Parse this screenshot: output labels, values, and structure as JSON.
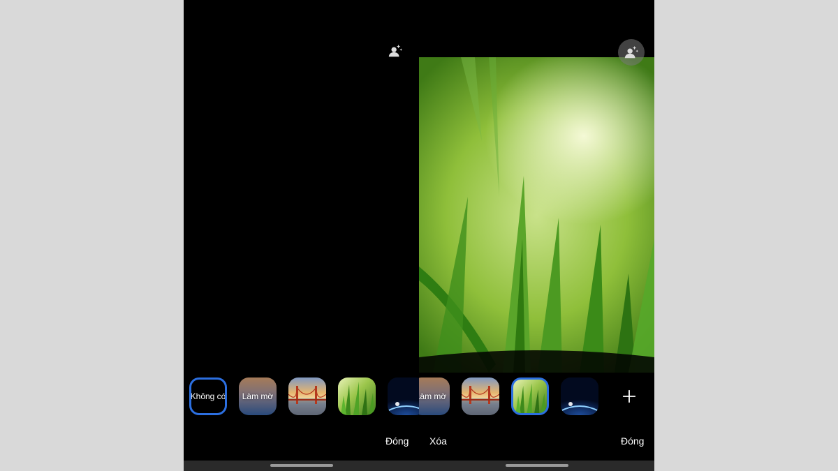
{
  "left_screen": {
    "options": [
      {
        "key": "none",
        "label": "Không có",
        "selected": true
      },
      {
        "key": "blur",
        "label": "Làm mờ",
        "selected": false
      },
      {
        "key": "bridge",
        "label": "",
        "selected": false
      },
      {
        "key": "grass",
        "label": "",
        "selected": false
      },
      {
        "key": "earth",
        "label": "",
        "selected": false
      }
    ],
    "close_label": "Đóng",
    "effect_icon": "person-sparkle-icon"
  },
  "right_screen": {
    "options": [
      {
        "key": "blur",
        "label": "Làm mờ",
        "selected": false
      },
      {
        "key": "bridge",
        "label": "",
        "selected": false
      },
      {
        "key": "grass",
        "label": "",
        "selected": true
      },
      {
        "key": "earth",
        "label": "",
        "selected": false
      }
    ],
    "delete_label": "Xóa",
    "close_label": "Đóng",
    "add_icon": "plus-icon",
    "effect_icon": "person-sparkle-icon"
  },
  "colors": {
    "selection_ring": "#2c6fe0",
    "background": "#000000",
    "frame": "#d9d9d9"
  }
}
